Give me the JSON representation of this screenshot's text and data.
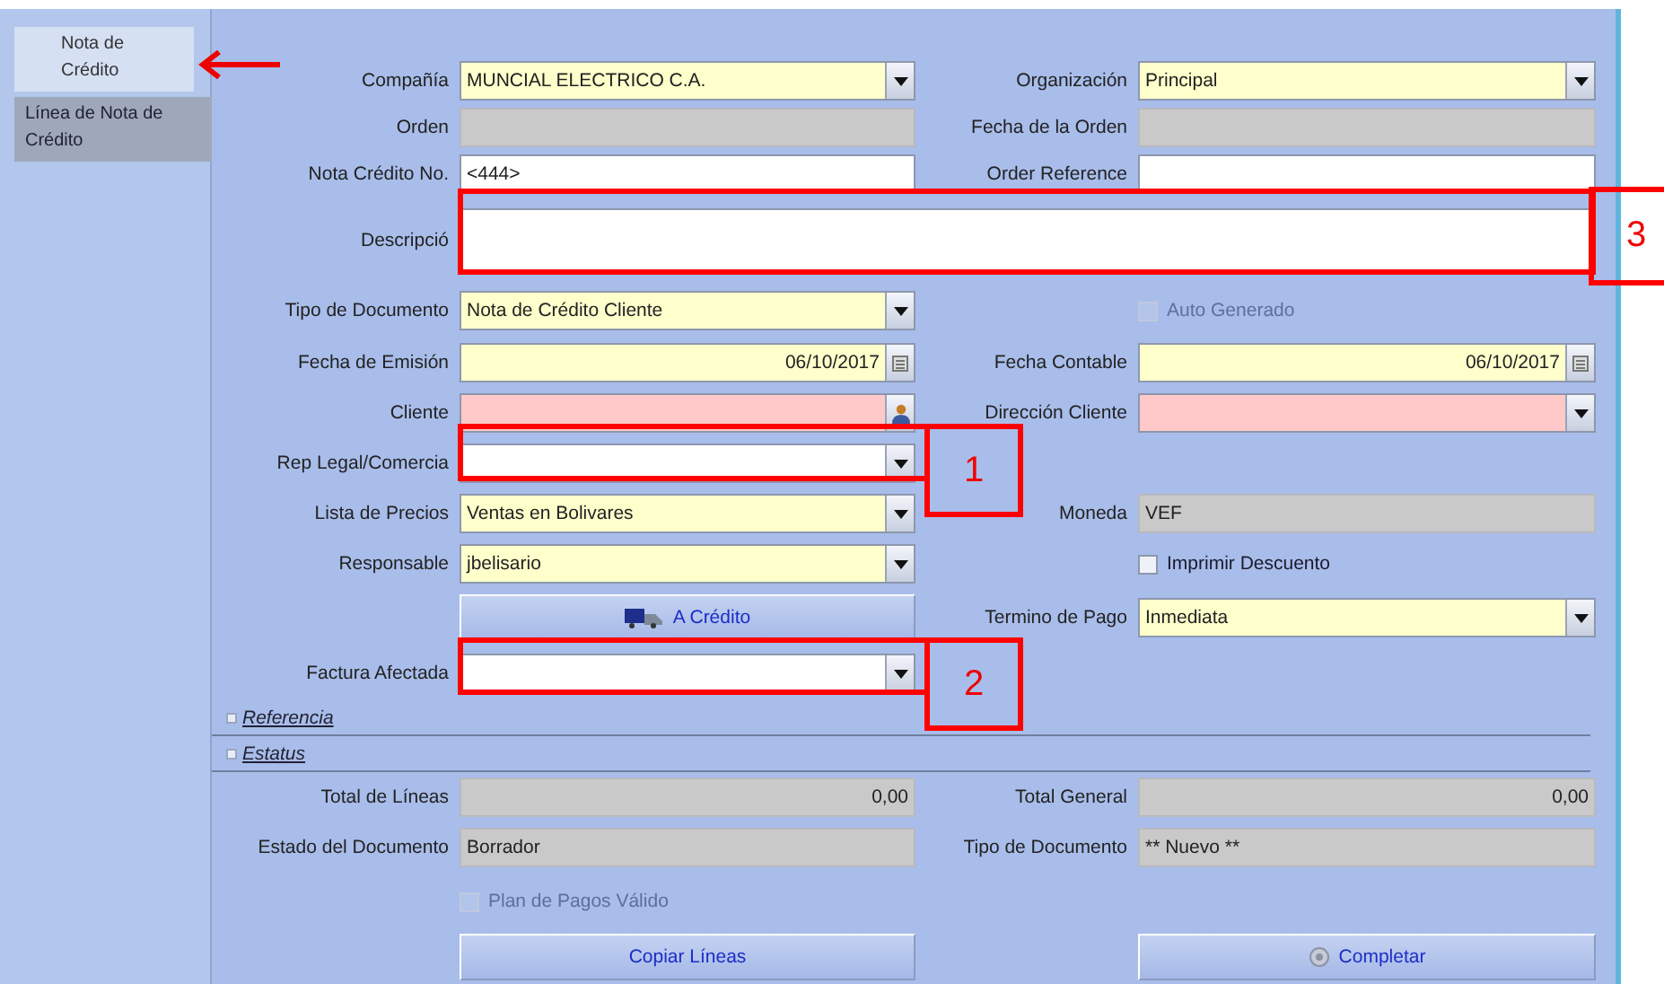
{
  "tabs": [
    {
      "label": "Nota de Crédito",
      "selected": true
    },
    {
      "label": "Línea de Nota de Crédito",
      "selected": false
    }
  ],
  "rows": [
    {
      "kind": "pair",
      "left": {
        "kind": "dropdown",
        "label": "Compañía",
        "value": "MUNCIAL ELECTRICO C.A.",
        "mandatory": true
      },
      "right": {
        "kind": "dropdown",
        "label": "Organización",
        "value": "Principal",
        "mandatory": true
      }
    },
    {
      "kind": "pair",
      "left": {
        "kind": "text",
        "label": "Orden",
        "readonly": true
      },
      "right": {
        "kind": "text",
        "label": "Fecha de la Orden",
        "readonly": true
      }
    },
    {
      "kind": "pair",
      "left": {
        "kind": "text",
        "label": "Nota Crédito No.",
        "value": "<444>"
      },
      "right": {
        "kind": "text",
        "label": "Order Reference"
      }
    },
    {
      "kind": "wide",
      "left": {
        "kind": "text",
        "label": "Descripció"
      }
    },
    {
      "kind": "pair",
      "left": {
        "kind": "dropdown",
        "label": "Tipo de Documento",
        "value": "Nota de Crédito Cliente",
        "mandatory": true
      },
      "right": {
        "kind": "checkbox",
        "label": "Auto Generado",
        "checked": false,
        "disabled": true
      }
    },
    {
      "kind": "pair",
      "left": {
        "kind": "date",
        "label": "Fecha de Emisión",
        "value": "06/10/2017",
        "mandatory": true
      },
      "right": {
        "kind": "date",
        "label": "Fecha Contable",
        "value": "06/10/2017",
        "mandatory": true
      }
    },
    {
      "kind": "pair",
      "left": {
        "kind": "lookup",
        "label": "Cliente",
        "error": true
      },
      "right": {
        "kind": "dropdown",
        "label": "Dirección Cliente",
        "error": true
      }
    },
    {
      "kind": "pair",
      "left": {
        "kind": "dropdown",
        "label": "Rep Legal/Comercia"
      }
    },
    {
      "kind": "pair",
      "left": {
        "kind": "dropdown",
        "label": "Lista de Precios",
        "value": "Ventas en Bolivares",
        "mandatory": true
      },
      "right": {
        "kind": "text",
        "label": "Moneda",
        "value": "VEF",
        "readonly": true
      }
    },
    {
      "kind": "pair",
      "left": {
        "kind": "dropdown",
        "label": "Responsable",
        "value": "jbelisario",
        "mandatory": true
      },
      "right": {
        "kind": "checkbox",
        "label": "Imprimir Descuento",
        "checked": false,
        "disabled": false
      }
    },
    {
      "kind": "pair",
      "left": {
        "kind": "process",
        "label": "A Crédito"
      },
      "right": {
        "kind": "dropdown",
        "label": "Termino de Pago",
        "value": "Inmediata",
        "mandatory": true
      }
    },
    {
      "kind": "pair",
      "left": {
        "kind": "dropdown",
        "label": "Factura Afectada"
      }
    },
    {
      "kind": "section",
      "label": "Referencia"
    },
    {
      "kind": "section",
      "label": "Estatus"
    },
    {
      "kind": "pair",
      "left": {
        "kind": "amount",
        "label": "Total de Líneas",
        "value": "0,00",
        "readonly": true
      },
      "right": {
        "kind": "amount",
        "label": "Total General",
        "value": "0,00",
        "readonly": true
      }
    },
    {
      "kind": "pair",
      "left": {
        "kind": "text",
        "label": "Estado del Documento",
        "value": "Borrador",
        "readonly": true
      },
      "right": {
        "kind": "text",
        "label": "Tipo de Documento",
        "value": "** Nuevo **",
        "readonly": true
      }
    },
    {
      "kind": "pair",
      "left": {
        "kind": "checkbox",
        "label": "Plan de Pagos Válido",
        "checked": false,
        "disabled": true
      }
    },
    {
      "kind": "pair",
      "left": {
        "kind": "button",
        "label": "Copiar Líneas"
      },
      "right": {
        "kind": "complete",
        "label": "Completar"
      }
    }
  ],
  "annotations": [
    {
      "kind": "arrow"
    },
    {
      "kind": "box",
      "number": "3"
    },
    {
      "kind": "box",
      "number": "1"
    },
    {
      "kind": "box",
      "number": "2"
    }
  ]
}
